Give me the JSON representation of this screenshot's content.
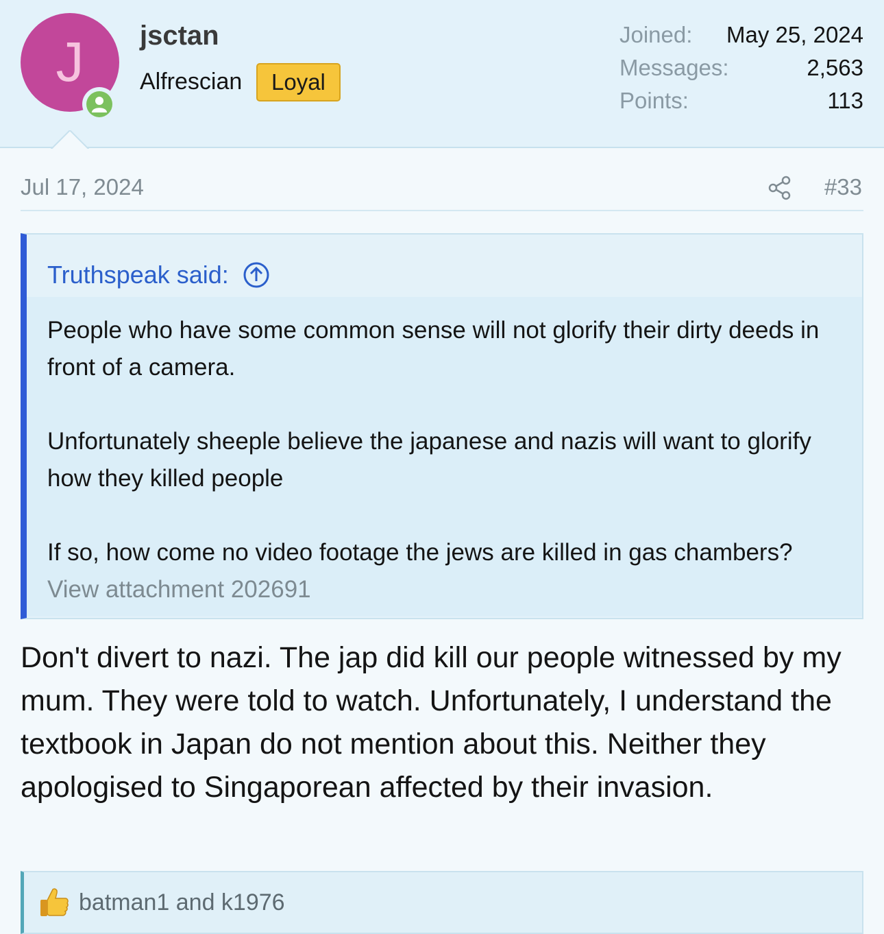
{
  "user": {
    "avatar_letter": "J",
    "username": "jsctan",
    "title": "Alfrescian",
    "banner": "Loyal",
    "stats": [
      {
        "label": "Joined:",
        "value": "May 25, 2024"
      },
      {
        "label": "Messages:",
        "value": "2,563"
      },
      {
        "label": "Points:",
        "value": "113"
      }
    ]
  },
  "post": {
    "date": "Jul 17, 2024",
    "number": "#33"
  },
  "quote": {
    "author": "Truthspeak said:",
    "paragraphs": [
      "People who have some common sense will not glorify their dirty deeds in front of a camera.",
      "Unfortunately sheeple believe the japanese and nazis will want to glorify how they killed people",
      "If so, how come no video footage the jews are killed in gas chambers?"
    ],
    "attachment_link": "View attachment 202691"
  },
  "message": "Don't divert to nazi. The jap did kill our people witnessed by my mum. They were told to watch. Unfortunately, I understand the textbook in Japan do not mention about this. Neither they apologised to Singaporean affected by their invasion.",
  "reactions": {
    "icon": "thumbs-up-icon",
    "names": "batman1 and k1976"
  },
  "colors": {
    "avatar_bg": "#c2479a",
    "online": "#7cc15e",
    "banner": "#f6c53b",
    "quote_accent": "#2f5bd6",
    "link": "#2b5fcb"
  }
}
